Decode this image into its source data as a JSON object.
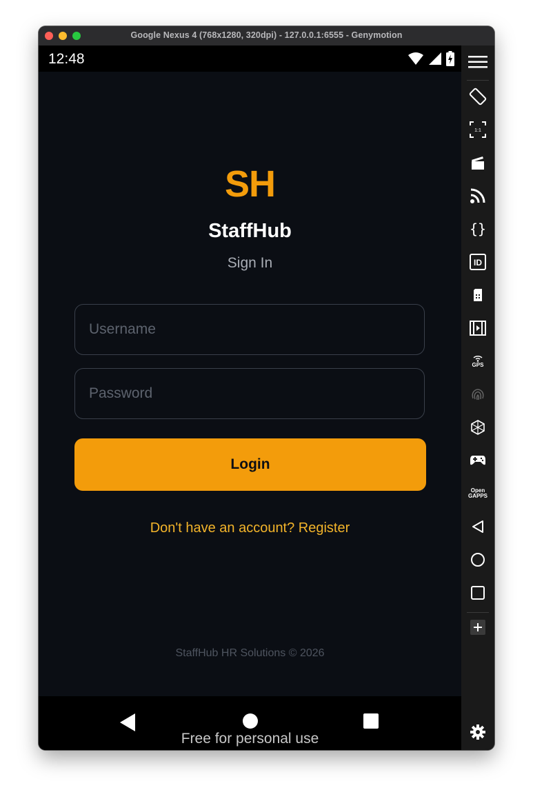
{
  "window": {
    "title": "Google Nexus 4 (768x1280, 320dpi) - 127.0.0.1:6555 - Genymotion"
  },
  "statusbar": {
    "time": "12:48",
    "icons": [
      "wifi-icon",
      "cell-signal-icon",
      "battery-charging-icon"
    ]
  },
  "app": {
    "logo": "SH",
    "name": "StaffHub",
    "subtitle": "Sign In",
    "username": {
      "value": "",
      "placeholder": "Username"
    },
    "password": {
      "value": "",
      "placeholder": "Password"
    },
    "login_label": "Login",
    "register_link": "Don't have an account? Register",
    "footer": "StaffHub HR Solutions © 2026",
    "colors": {
      "accent": "#f39c0b",
      "background": "#0b0e14",
      "link": "#f3b42a"
    }
  },
  "navbar": {
    "items": [
      "back-icon",
      "home-icon",
      "recents-icon"
    ],
    "watermark": "Free for personal use"
  },
  "sidebar": {
    "tools": [
      "menu-icon",
      "rotate-icon",
      "pixel-perfect-icon",
      "capture-icon",
      "cast-icon",
      "shell-icon",
      "device-id-icon",
      "sim-card-icon",
      "media-icon",
      "gps-icon",
      "fingerprint-icon",
      "motion-sensor-icon",
      "gamepad-icon",
      "open-gapps-icon",
      "back-icon",
      "home-icon",
      "recents-icon",
      "add-icon",
      "settings-icon"
    ],
    "gps_label": "GPS",
    "opengapps_label": "Open GAPPS"
  }
}
